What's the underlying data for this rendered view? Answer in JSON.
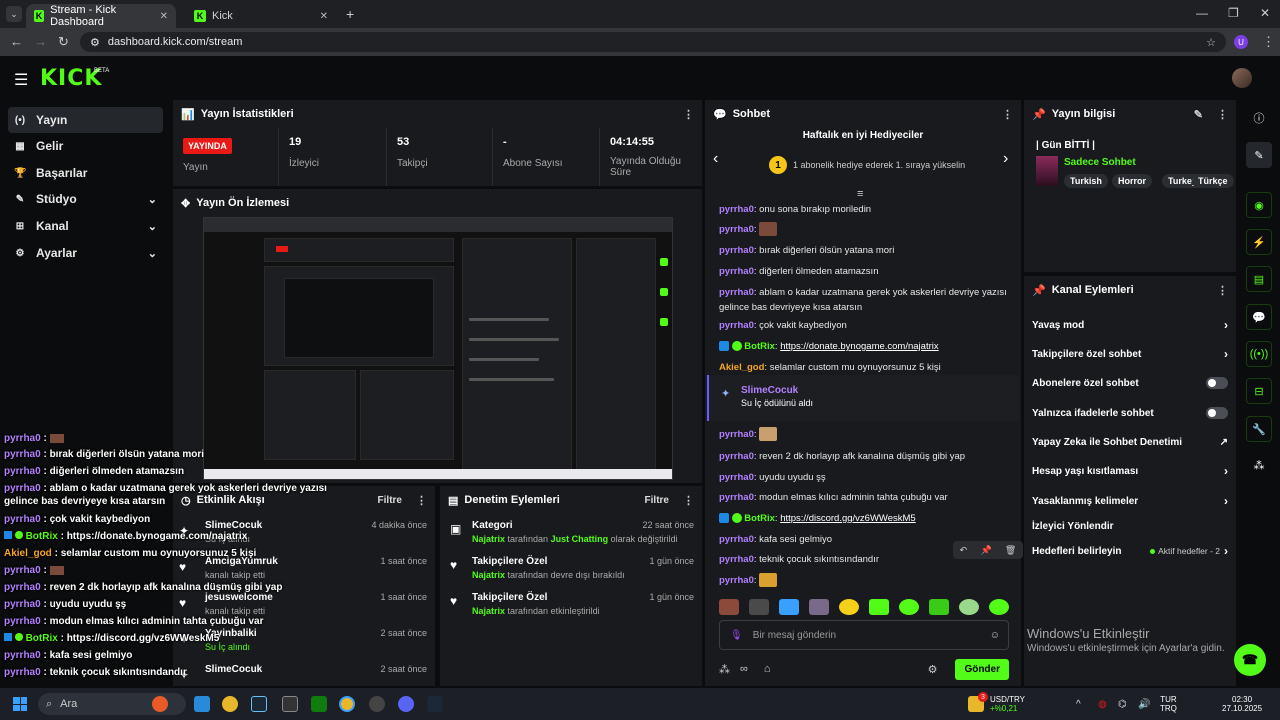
{
  "browser": {
    "tabs": [
      {
        "title": "Stream - Kick Dashboard",
        "active": true
      },
      {
        "title": "Kick",
        "active": false
      }
    ],
    "url": "dashboard.kick.com/stream",
    "profile_letter": "U"
  },
  "header": {
    "logo": "KICK",
    "beta": "BETA"
  },
  "leftnav": {
    "items": [
      {
        "label": "Yayın",
        "icon": "broadcast-icon",
        "glyph": "(•)"
      },
      {
        "label": "Gelir",
        "icon": "revenue-icon",
        "glyph": "▦"
      },
      {
        "label": "Başarılar",
        "icon": "trophy-icon",
        "glyph": "🏆"
      },
      {
        "label": "Stüdyo",
        "icon": "studio-icon",
        "glyph": "✎"
      },
      {
        "label": "Kanal",
        "icon": "channel-icon",
        "glyph": "⊞"
      },
      {
        "label": "Ayarlar",
        "icon": "gear-icon",
        "glyph": "⚙"
      }
    ]
  },
  "stats": {
    "title": "Yayın İstatistikleri",
    "live_badge": "YAYINDA",
    "live_label": "Yayın",
    "cells": [
      {
        "value": "19",
        "label": "İzleyici"
      },
      {
        "value": "53",
        "label": "Takipçi"
      },
      {
        "value": "-",
        "label": "Abone Sayısı"
      },
      {
        "value": "04:14:55",
        "label": "Yayında Olduğu Süre"
      }
    ]
  },
  "preview": {
    "title": "Yayın Ön İzlemesi"
  },
  "activity": {
    "title": "Etkinlik Akışı",
    "filter": "Filtre",
    "rows": [
      {
        "name": "SlimeCocuk",
        "time": "4 dakika önce",
        "sub": "Su İç alındı",
        "green": false
      },
      {
        "name": "AmcigaYumruk",
        "time": "1 saat önce",
        "sub": "kanalı takip etti",
        "green": false
      },
      {
        "name": "jesuswelcome",
        "time": "1 saat önce",
        "sub": "kanalı takip etti",
        "green": false
      },
      {
        "name": "Yayinbaliki",
        "time": "2 saat önce",
        "sub": "Su İç alındı",
        "green": true
      },
      {
        "name": "SlimeCocuk",
        "time": "2 saat önce",
        "sub": "",
        "green": false
      }
    ]
  },
  "moderation": {
    "title": "Denetim Eylemleri",
    "filter": "Filtre",
    "rows": [
      {
        "title": "Kategori",
        "time": "22 saat önce",
        "actor": "Najatrix",
        "pre": " tarafından ",
        "highlight": "Just Chatting",
        "post": " olarak değiştirildi",
        "icon": "category-icon",
        "glyph": "▣"
      },
      {
        "title": "Takipçilere Özel",
        "time": "1 gün önce",
        "actor": "Najatrix",
        "pre": " tarafından devre dışı bırakıldı",
        "highlight": "",
        "post": "",
        "icon": "heart-icon",
        "glyph": "♥"
      },
      {
        "title": "Takipçilere Özel",
        "time": "1 gün önce",
        "actor": "Najatrix",
        "pre": " tarafından etkinleştirildi",
        "highlight": "",
        "post": "",
        "icon": "heart-icon",
        "glyph": "♥"
      }
    ]
  },
  "chat": {
    "title": "Sohbet",
    "gift_title": "Haftalık en iyi Hediyeciler",
    "gift_rank": "1",
    "gift_text": "1 abonelik hediye ederek 1. sıraya yükselin",
    "messages": [
      {
        "user": "pyrrha0",
        "text": "onu sona bırakıp moriledin",
        "kind": "user"
      },
      {
        "user": "pyrrha0",
        "text": "",
        "kind": "emote"
      },
      {
        "user": "pyrrha0",
        "text": "bırak diğerleri ölsün yatana mori",
        "kind": "user"
      },
      {
        "user": "pyrrha0",
        "text": "diğerleri ölmeden atamazsın",
        "kind": "user"
      },
      {
        "user": "pyrrha0",
        "text": "ablam o kadar uzatmana gerek yok askerleri devriye yazısı gelince bas devriyeye kısa atarsın",
        "kind": "user"
      },
      {
        "user": "pyrrha0",
        "text": "çok vakit kaybediyon",
        "kind": "user"
      },
      {
        "user": "BotRix",
        "text": "https://donate.bynogame.com/najatrix",
        "kind": "bot"
      },
      {
        "user": "Akiel_god",
        "text": "selamlar custom mu oynuyorsunuz 5 kişi",
        "kind": "akiel"
      },
      {
        "user": "pyrrha0",
        "text": "",
        "kind": "emote"
      },
      {
        "user": "pyrrha0",
        "text": "reven 2 dk horlayıp afk kanalına düşmüş gibi yap",
        "kind": "user"
      },
      {
        "user": "pyrrha0",
        "text": "uyudu uyudu şş",
        "kind": "user"
      },
      {
        "user": "pyrrha0",
        "text": "modun elmas kılıcı adminin tahta çubuğu var",
        "kind": "user"
      },
      {
        "user": "BotRix",
        "text": "https://discord.gg/vz6WWeskM5",
        "kind": "bot"
      },
      {
        "user": "pyrrha0",
        "text": "kafa sesi gelmiyo",
        "kind": "user"
      },
      {
        "user": "pyrrha0",
        "text": "teknik çocuk sıkıntısındandır",
        "kind": "user"
      },
      {
        "user": "pyrrha0",
        "text": "",
        "kind": "emote"
      }
    ],
    "sub_alert": {
      "user": "SlimeCocuk",
      "text": "Su İç ödülünü aldı"
    },
    "input_placeholder": "Bir mesaj gönderin",
    "send_label": "Gönder"
  },
  "stream_info": {
    "title": "Yayın bilgisi",
    "stream_title": "| Gün BİTTİ |",
    "category": "Sadece Sohbet",
    "tags": [
      "Turkish",
      "Horror",
      "Turkey",
      "Türkçe"
    ]
  },
  "channel_actions": {
    "title": "Kanal Eylemleri",
    "items": [
      {
        "label": "Yavaş mod",
        "control": "chevron"
      },
      {
        "label": "Takipçilere özel sohbet",
        "control": "chevron"
      },
      {
        "label": "Abonelere özel sohbet",
        "control": "toggle"
      },
      {
        "label": "Yalnızca ifadelerle sohbet",
        "control": "toggle"
      },
      {
        "label": "Yapay Zeka ile Sohbet Denetimi",
        "control": "external"
      },
      {
        "label": "Hesap yaşı kısıtlaması",
        "control": "chevron"
      },
      {
        "label": "Yasaklanmış kelimeler",
        "control": "chevron"
      },
      {
        "label": "İzleyici Yönlendir",
        "control": "none"
      },
      {
        "label": "Hedefleri belirleyin",
        "control": "goals"
      }
    ],
    "goals_text": "Aktif hedefler - 2"
  },
  "watermark": {
    "line1": "Windows'u Etkinleştir",
    "line2": "Windows'u etkinleştirmek için Ayarlar'a gidin."
  },
  "overlay_chat": [
    {
      "user": "pyrrha0",
      "text": "",
      "kind": "emote"
    },
    {
      "user": "pyrrha0",
      "text": "bırak diğerleri ölsün yatana mori",
      "kind": "user"
    },
    {
      "user": "pyrrha0",
      "text": "diğerleri ölmeden atamazsın",
      "kind": "user"
    },
    {
      "user": "pyrrha0",
      "text": "ablam o kadar uzatmana gerek yok askerleri devriye yazısı gelince bas devriyeye kısa atarsın",
      "kind": "user"
    },
    {
      "user": "pyrrha0",
      "text": "çok vakit kaybediyon",
      "kind": "user"
    },
    {
      "user": "BotRix",
      "text": "https://donate.bynogame.com/najatrix",
      "kind": "bot"
    },
    {
      "user": "Akiel_god",
      "text": "selamlar custom mu oynuyorsunuz 5 kişi",
      "kind": "akiel"
    },
    {
      "user": "pyrrha0",
      "text": "",
      "kind": "emote"
    },
    {
      "user": "pyrrha0",
      "text": "reven 2 dk horlayıp afk kanalına düşmüş gibi yap",
      "kind": "user"
    },
    {
      "user": "pyrrha0",
      "text": "uyudu uyudu şş",
      "kind": "user"
    },
    {
      "user": "pyrrha0",
      "text": "modun elmas kılıcı adminin tahta çubuğu var",
      "kind": "user"
    },
    {
      "user": "BotRix",
      "text": "https://discord.gg/vz6WWeskM5",
      "kind": "bot"
    },
    {
      "user": "pyrrha0",
      "text": "kafa sesi gelmiyo",
      "kind": "user"
    },
    {
      "user": "pyrrha0",
      "text": "teknik çocuk sıkıntısındandır",
      "kind": "user"
    }
  ],
  "taskbar": {
    "search": "Ara",
    "badge_count": "3",
    "currency": "USD/TRY",
    "currency_change": "+%0,21",
    "lang1": "TUR",
    "lang2": "TRQ",
    "time": "02:30",
    "date": "27.10.2025"
  }
}
